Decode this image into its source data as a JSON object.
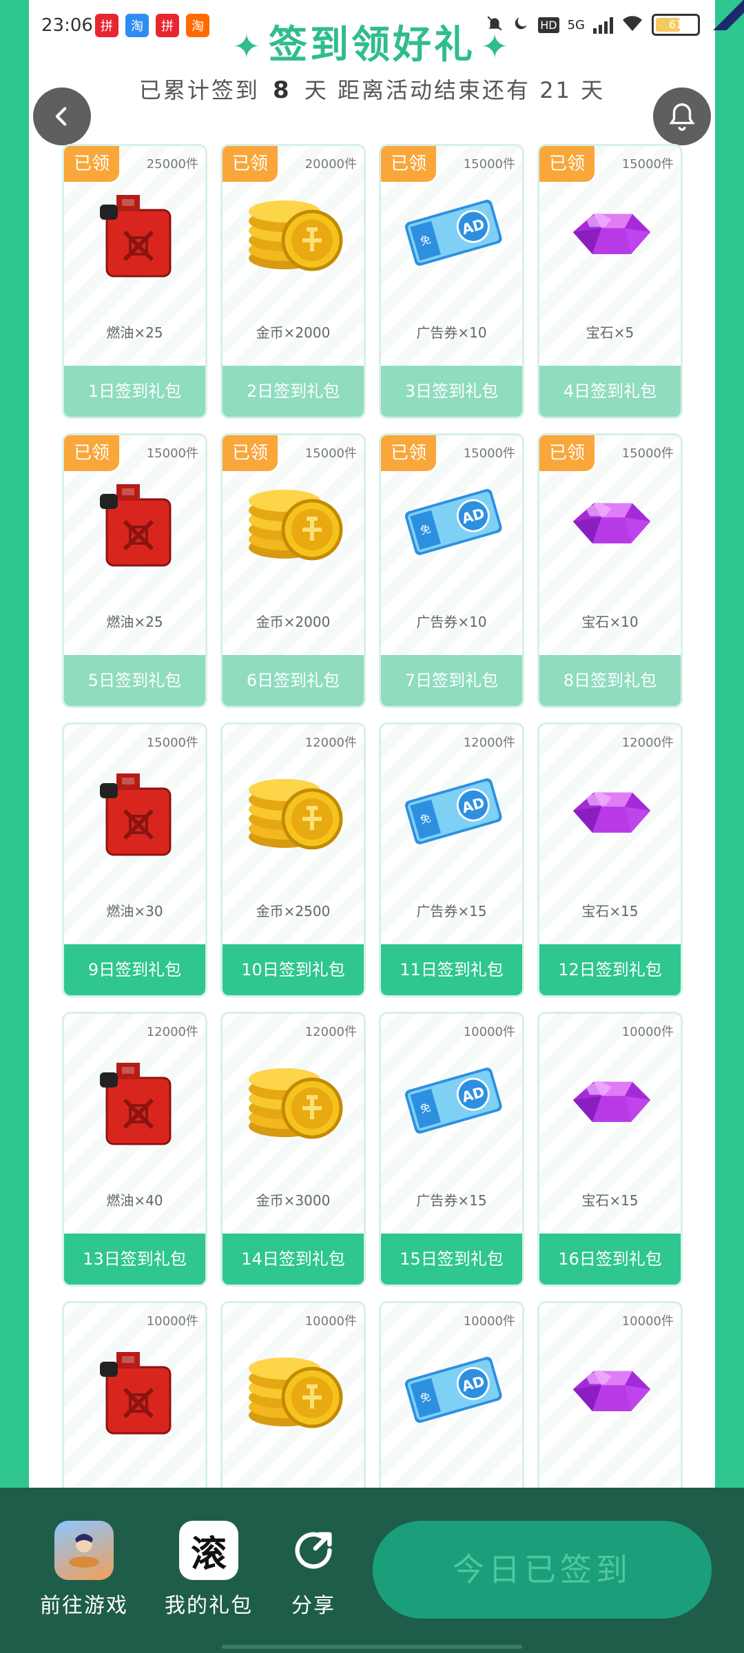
{
  "status_bar": {
    "time": "23:06",
    "apps": [
      "拼",
      "淘",
      "拼",
      "淘"
    ],
    "net": "5G",
    "hd": "HD",
    "battery": "61",
    "battery_level": 0.61
  },
  "header": {
    "title": "签到领好礼",
    "subtitle_prefix": "已累计签到",
    "signed_days": "8",
    "subtitle_mid": "天  距离活动结束还有",
    "days_left": "21",
    "subtitle_suffix": "天"
  },
  "cards": [
    {
      "badge": "已领",
      "stock": "25000件",
      "icon": "fuel-can-icon",
      "name": "燃油×25",
      "pack": "1日签到礼包",
      "claimed": true
    },
    {
      "badge": "已领",
      "stock": "20000件",
      "icon": "gold-coins-icon",
      "name": "金币×2000",
      "pack": "2日签到礼包",
      "claimed": true
    },
    {
      "badge": "已领",
      "stock": "15000件",
      "icon": "ad-ticket-icon",
      "name": "广告券×10",
      "pack": "3日签到礼包",
      "claimed": true
    },
    {
      "badge": "已领",
      "stock": "15000件",
      "icon": "gem-icon",
      "name": "宝石×5",
      "pack": "4日签到礼包",
      "claimed": true
    },
    {
      "badge": "已领",
      "stock": "15000件",
      "icon": "fuel-can-icon",
      "name": "燃油×25",
      "pack": "5日签到礼包",
      "claimed": true
    },
    {
      "badge": "已领",
      "stock": "15000件",
      "icon": "gold-coins-icon",
      "name": "金币×2000",
      "pack": "6日签到礼包",
      "claimed": true
    },
    {
      "badge": "已领",
      "stock": "15000件",
      "icon": "ad-ticket-icon",
      "name": "广告券×10",
      "pack": "7日签到礼包",
      "claimed": true
    },
    {
      "badge": "已领",
      "stock": "15000件",
      "icon": "gem-icon",
      "name": "宝石×10",
      "pack": "8日签到礼包",
      "claimed": true
    },
    {
      "badge": "",
      "stock": "15000件",
      "icon": "fuel-can-icon",
      "name": "燃油×30",
      "pack": "9日签到礼包",
      "claimed": false
    },
    {
      "badge": "",
      "stock": "12000件",
      "icon": "gold-coins-icon",
      "name": "金币×2500",
      "pack": "10日签到礼包",
      "claimed": false
    },
    {
      "badge": "",
      "stock": "12000件",
      "icon": "ad-ticket-icon",
      "name": "广告券×15",
      "pack": "11日签到礼包",
      "claimed": false
    },
    {
      "badge": "",
      "stock": "12000件",
      "icon": "gem-icon",
      "name": "宝石×15",
      "pack": "12日签到礼包",
      "claimed": false
    },
    {
      "badge": "",
      "stock": "12000件",
      "icon": "fuel-can-icon",
      "name": "燃油×40",
      "pack": "13日签到礼包",
      "claimed": false
    },
    {
      "badge": "",
      "stock": "12000件",
      "icon": "gold-coins-icon",
      "name": "金币×3000",
      "pack": "14日签到礼包",
      "claimed": false
    },
    {
      "badge": "",
      "stock": "10000件",
      "icon": "ad-ticket-icon",
      "name": "广告券×15",
      "pack": "15日签到礼包",
      "claimed": false
    },
    {
      "badge": "",
      "stock": "10000件",
      "icon": "gem-icon",
      "name": "宝石×15",
      "pack": "16日签到礼包",
      "claimed": false
    },
    {
      "badge": "",
      "stock": "10000件",
      "icon": "fuel-can-icon",
      "name": "",
      "pack": "",
      "claimed": false
    },
    {
      "badge": "",
      "stock": "10000件",
      "icon": "gold-coins-icon",
      "name": "",
      "pack": "",
      "claimed": false
    },
    {
      "badge": "",
      "stock": "10000件",
      "icon": "ad-ticket-icon",
      "name": "",
      "pack": "",
      "claimed": false
    },
    {
      "badge": "",
      "stock": "10000件",
      "icon": "gem-icon",
      "name": "",
      "pack": "",
      "claimed": false
    }
  ],
  "bottom_nav": {
    "game_label": "前往游戏",
    "gift_label": "我的礼包",
    "gift_glyph": "滚",
    "share_label": "分享",
    "signed_button": "今日已签到"
  },
  "colors": {
    "accent": "#2fc690",
    "claimed_badge": "#f9a63a",
    "claimed_button": "#8fdcbf",
    "bottom_bar": "#1f5d4b"
  }
}
